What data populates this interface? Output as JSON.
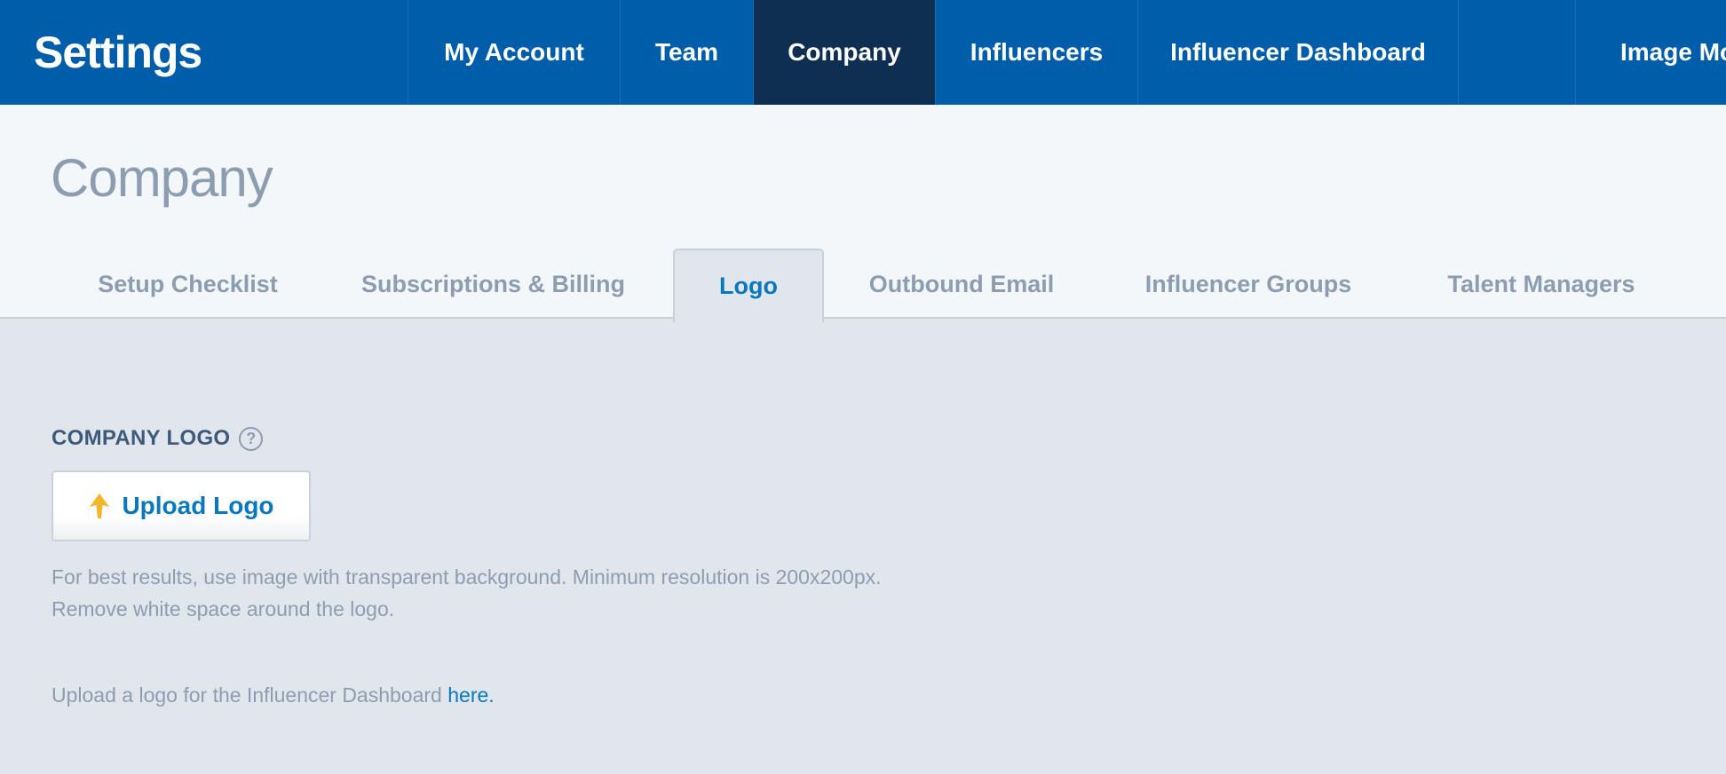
{
  "app": {
    "title": "Settings"
  },
  "nav": {
    "items": [
      {
        "label": "My Account",
        "active": false
      },
      {
        "label": "Team",
        "active": false
      },
      {
        "label": "Company",
        "active": true
      },
      {
        "label": "Influencers",
        "active": false
      },
      {
        "label": "Influencer Dashboard",
        "active": false
      },
      {
        "label": "Image Mo",
        "active": false
      }
    ]
  },
  "page": {
    "title": "Company"
  },
  "tabs": [
    {
      "label": "Setup Checklist",
      "active": false
    },
    {
      "label": "Subscriptions & Billing",
      "active": false
    },
    {
      "label": "Logo",
      "active": true
    },
    {
      "label": "Outbound Email",
      "active": false
    },
    {
      "label": "Influencer Groups",
      "active": false
    },
    {
      "label": "Talent Managers",
      "active": false
    }
  ],
  "logo_section": {
    "label": "COMPANY LOGO",
    "help_icon": "question-circle-icon",
    "help_glyph": "?",
    "upload_icon": "upload-arrow-icon",
    "upload_label": "Upload Logo",
    "hint_line1": "For best results, use image with transparent background. Minimum resolution is 200x200px.",
    "hint_line2": "Remove white space around the logo.",
    "dashboard_note": "Upload a logo for the Influencer Dashboard ",
    "dashboard_link": "here."
  },
  "colors": {
    "topbar": "#005da9",
    "nav_active": "#0e2f52",
    "accent": "#0a78bf",
    "upload_arrow": "#f5b52a",
    "muted_text": "#8c9db2"
  }
}
